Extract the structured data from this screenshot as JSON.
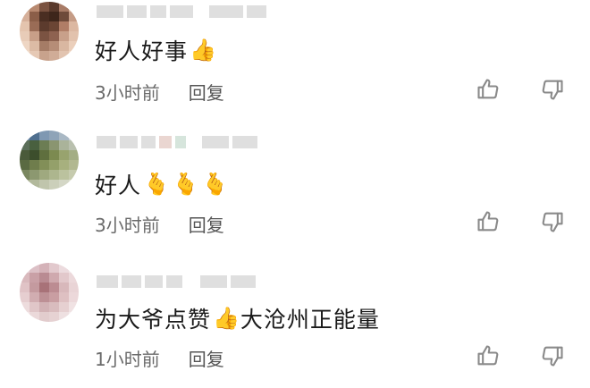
{
  "comments": [
    {
      "text": "好人好事",
      "emojis": [
        "👍"
      ],
      "time": "3小时前",
      "reply_label": "回复",
      "like_icon": "thumbs-up-outline",
      "dislike_icon": "thumbs-down-outline"
    },
    {
      "text": "好人",
      "emojis": [
        "🫰",
        "🫰",
        "🫰"
      ],
      "time": "3小时前",
      "reply_label": "回复",
      "like_icon": "thumbs-up-outline",
      "dislike_icon": "thumbs-down-outline"
    },
    {
      "text": "为大爷点赞",
      "emojis": [
        "👍"
      ],
      "text_after": "大沧州正能量",
      "time": "1小时前",
      "reply_label": "回复",
      "like_icon": "thumbs-up-outline",
      "dislike_icon": "thumbs-down-outline"
    }
  ],
  "colors": {
    "text": "#1a1a1a",
    "meta": "#6b6b6b",
    "icon": "#8a8a8a",
    "blur": "#d9d9d9"
  }
}
